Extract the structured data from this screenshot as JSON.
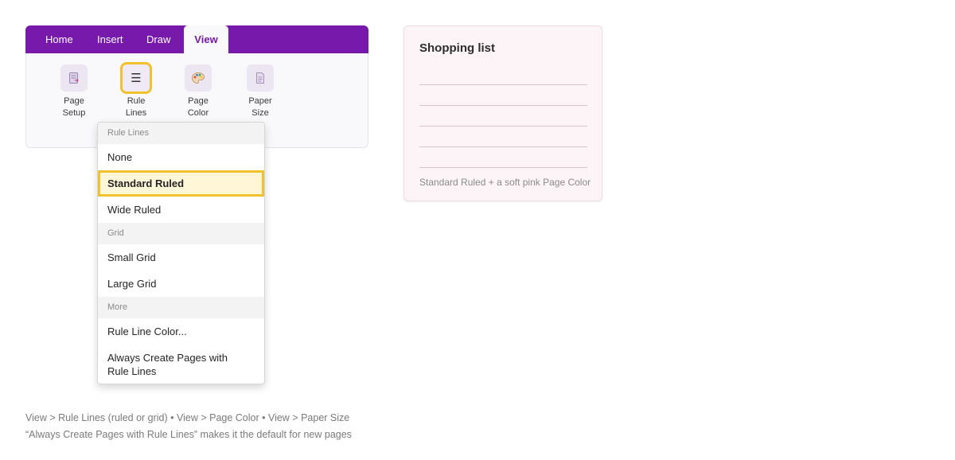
{
  "ribbon": {
    "tabs": [
      {
        "label": "Home"
      },
      {
        "label": "Insert"
      },
      {
        "label": "Draw"
      },
      {
        "label": "View",
        "active": true
      }
    ],
    "buttons": [
      {
        "label1": "Page",
        "label2": "Setup",
        "icon": "page-setup-icon"
      },
      {
        "label1": "Rule",
        "label2": "Lines",
        "icon": "rule-lines-icon",
        "glyph": "☰",
        "focused": true
      },
      {
        "label1": "Page",
        "label2": "Color",
        "icon": "palette-icon",
        "glyph": "🎨"
      },
      {
        "label1": "Paper",
        "label2": "Size",
        "icon": "paper-size-icon"
      }
    ]
  },
  "menu": {
    "sections": [
      {
        "header": "Rule Lines",
        "items": [
          "None",
          "Standard Ruled",
          "Wide Ruled"
        ]
      },
      {
        "header": "Grid",
        "items": [
          "Small Grid",
          "Large Grid"
        ]
      },
      {
        "header": "More",
        "items": [
          "Rule Line Color...",
          "Always Create Pages with Rule Lines"
        ]
      }
    ],
    "selected": "Standard Ruled"
  },
  "preview": {
    "title": "Shopping list",
    "note": "Standard Ruled + a soft pink Page Color",
    "page_color": "#fcf4f6",
    "rule_color": "#d8c4cc"
  },
  "footer": {
    "line1": "View > Rule Lines (ruled or grid)  •  View > Page Color  •  View > Paper Size",
    "line2": "“Always Create Pages with Rule Lines” makes it the default for new pages"
  },
  "colors": {
    "accent": "#7719aa",
    "focus": "#f2c12e"
  }
}
